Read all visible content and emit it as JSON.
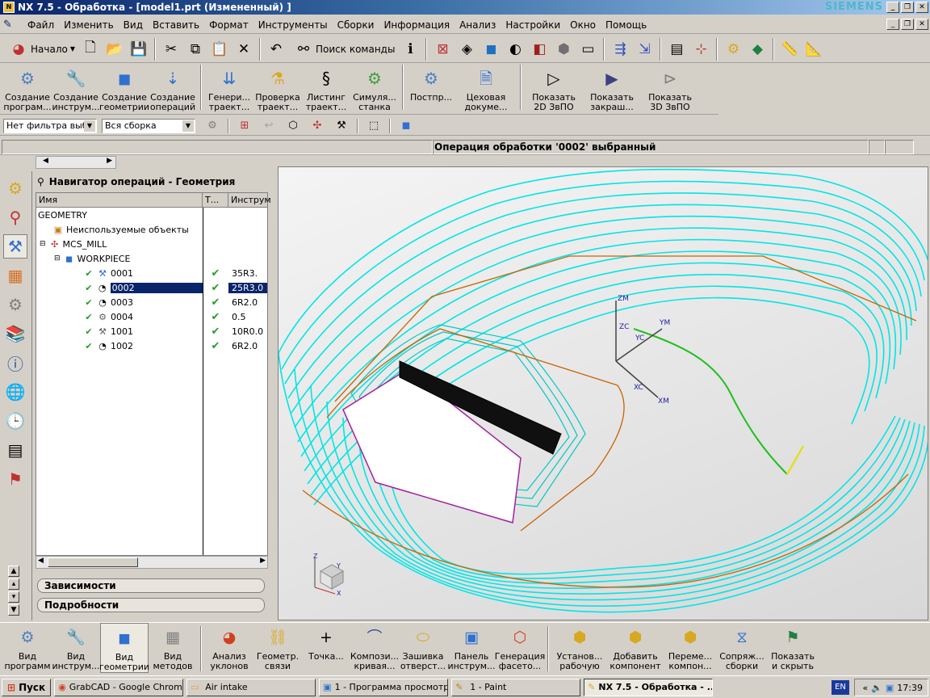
{
  "window": {
    "title": "NX 7.5 - Обработка - [model1.prt (Измененный) ]",
    "brand": "SIEMENS"
  },
  "menu": [
    "Файл",
    "Изменить",
    "Вид",
    "Вставить",
    "Формат",
    "Инструменты",
    "Сборки",
    "Информация",
    "Анализ",
    "Настройки",
    "Окно",
    "Помощь"
  ],
  "toolbar1": {
    "start_label": "Начало",
    "search_label": "Поиск команды"
  },
  "toolbar2": [
    {
      "l1": "Создание",
      "l2": "програм..."
    },
    {
      "l1": "Создание",
      "l2": "инструм..."
    },
    {
      "l1": "Создание",
      "l2": "геометрии"
    },
    {
      "l1": "Создание",
      "l2": "операций"
    },
    {
      "l1": "Генери...",
      "l2": "траект..."
    },
    {
      "l1": "Проверка",
      "l2": "траект..."
    },
    {
      "l1": "Листинг",
      "l2": "траект..."
    },
    {
      "l1": "Симуля...",
      "l2": "станка"
    },
    {
      "l1": "Постпр...",
      "l2": ""
    },
    {
      "l1": "Цеховая",
      "l2": "докуме..."
    },
    {
      "l1": "Показать",
      "l2": "2D ЗвПО"
    },
    {
      "l1": "Показать",
      "l2": "закраш..."
    },
    {
      "l1": "Показать",
      "l2": "3D ЗвПО"
    }
  ],
  "filter": {
    "type_filter": "Нет фильтра выбо",
    "scope": "Вся сборка"
  },
  "status": "Операция обработки '0002' выбранный",
  "navigator": {
    "title": "Навигатор операций - Геометрия",
    "columns": [
      "Имя",
      "Т...",
      "Инструм"
    ],
    "rows": [
      {
        "name": "GEOMETRY",
        "check": "",
        "tool": ""
      },
      {
        "name": "Неиспользуемые объекты",
        "check": "",
        "tool": ""
      },
      {
        "name": "MCS_MILL",
        "check": "",
        "tool": ""
      },
      {
        "name": "WORKPIECE",
        "check": "",
        "tool": ""
      },
      {
        "name": "0001",
        "check": "✔",
        "tool": "35R3."
      },
      {
        "name": "0002",
        "check": "✔",
        "tool": "25R3.0"
      },
      {
        "name": "0003",
        "check": "✔",
        "tool": "6R2.0"
      },
      {
        "name": "0004",
        "check": "✔",
        "tool": "0.5"
      },
      {
        "name": "1001",
        "check": "✔",
        "tool": "10R0.0"
      },
      {
        "name": "1002",
        "check": "✔",
        "tool": "6R2.0"
      }
    ],
    "dependencies": "Зависимости",
    "details": "Подробности"
  },
  "viewport": {
    "axis_labels": [
      "ZM",
      "ZC",
      "YM",
      "YC",
      "XC",
      "XM"
    ],
    "triad": [
      "Z",
      "Y",
      "X"
    ]
  },
  "bottom_toolbar": [
    {
      "l1": "Вид",
      "l2": "программ"
    },
    {
      "l1": "Вид",
      "l2": "инструм..."
    },
    {
      "l1": "Вид",
      "l2": "геометрии"
    },
    {
      "l1": "Вид",
      "l2": "методов"
    },
    {
      "l1": "Анализ",
      "l2": "уклонов"
    },
    {
      "l1": "Геометр.",
      "l2": "связи"
    },
    {
      "l1": "Точка...",
      "l2": ""
    },
    {
      "l1": "Компози...",
      "l2": "кривая..."
    },
    {
      "l1": "Зашивка",
      "l2": "отверст..."
    },
    {
      "l1": "Панель",
      "l2": "инструм..."
    },
    {
      "l1": "Генерация",
      "l2": "фасето..."
    },
    {
      "l1": "Установ...",
      "l2": "рабочую"
    },
    {
      "l1": "Добавить",
      "l2": "компонент"
    },
    {
      "l1": "Переме...",
      "l2": "компон..."
    },
    {
      "l1": "Сопряж...",
      "l2": "сборки"
    },
    {
      "l1": "Показать",
      "l2": "и скрыть"
    }
  ],
  "taskbar": {
    "start": "Пуск",
    "tasks": [
      "GrabCAD - Google Chrome",
      "Air intake",
      "1 - Программа просмотр...",
      "1 - Paint",
      "NX 7.5 - Обработка - ..."
    ],
    "lang": "EN",
    "clock": "17:39"
  },
  "colors": {
    "toolpath": "#00e6e6",
    "selection": "#0a246a",
    "boundary": "#c86400"
  }
}
